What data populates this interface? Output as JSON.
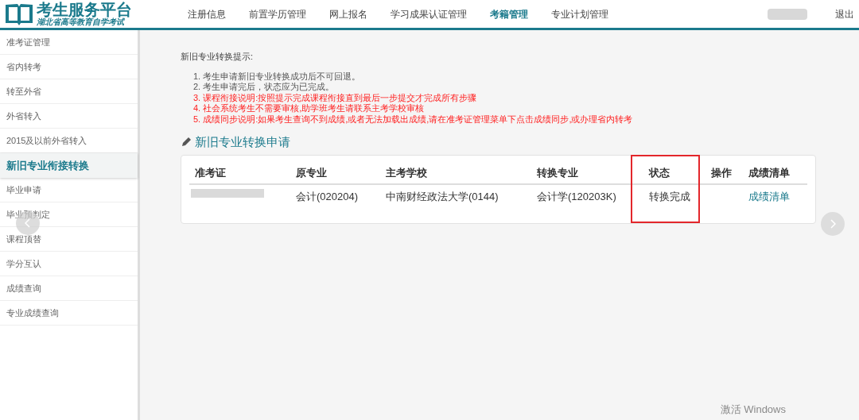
{
  "logo": {
    "title": "考生服务平台",
    "subtitle": "湖北省高等教育自学考试"
  },
  "nav": [
    {
      "label": "注册信息",
      "selected": false
    },
    {
      "label": "前置学历管理",
      "selected": false
    },
    {
      "label": "网上报名",
      "selected": false
    },
    {
      "label": "学习成果认证管理",
      "selected": false
    },
    {
      "label": "考籍管理",
      "selected": true
    },
    {
      "label": "专业计划管理",
      "selected": false
    }
  ],
  "logout": "退出",
  "sidebar": {
    "items": [
      {
        "label": "准考证管理",
        "selected": false
      },
      {
        "label": "省内转考",
        "selected": false
      },
      {
        "label": "转至外省",
        "selected": false
      },
      {
        "label": "外省转入",
        "selected": false
      },
      {
        "label": "2015及以前外省转入",
        "selected": false
      },
      {
        "label": "新旧专业衔接转换",
        "selected": true
      },
      {
        "label": "毕业申请",
        "selected": false
      },
      {
        "label": "毕业预判定",
        "selected": false
      },
      {
        "label": "课程顶替",
        "selected": false
      },
      {
        "label": "学分互认",
        "selected": false
      },
      {
        "label": "成绩查询",
        "selected": false
      },
      {
        "label": "专业成绩查询",
        "selected": false
      }
    ]
  },
  "notice": {
    "title": "新旧专业转换提示:",
    "items": [
      {
        "text": "1. 考生申请新旧专业转换成功后不可回退。",
        "kind": "normal"
      },
      {
        "text": "2. 考生申请完后，状态应为已完成。",
        "kind": "normal"
      },
      {
        "text": "3. 课程衔接说明:按照提示完成课程衔接直到最后一步提交才完成所有步骤",
        "kind": "warning"
      },
      {
        "text": "4. 社会系统考生不需要审核,助学班考生请联系主考学校审核",
        "kind": "warning"
      },
      {
        "text": "5. 成绩同步说明:如果考生查询不到成绩,或者无法加载出成绩,请在准考证管理菜单下点击成绩同步,或办理省内转考",
        "kind": "warning"
      }
    ]
  },
  "section_title": "新旧专业转换申请",
  "table": {
    "columns": [
      "准考证",
      "原专业",
      "主考学校",
      "转换专业",
      "状态",
      "操作",
      "成绩清单"
    ],
    "rows": [
      {
        "original_major": "会计(020204)",
        "school": "中南财经政法大学(0144)",
        "new_major": "会计学(120203K)",
        "status": "转换完成",
        "report_link": "成绩清单"
      }
    ]
  },
  "system_notice": "激活 Windows"
}
